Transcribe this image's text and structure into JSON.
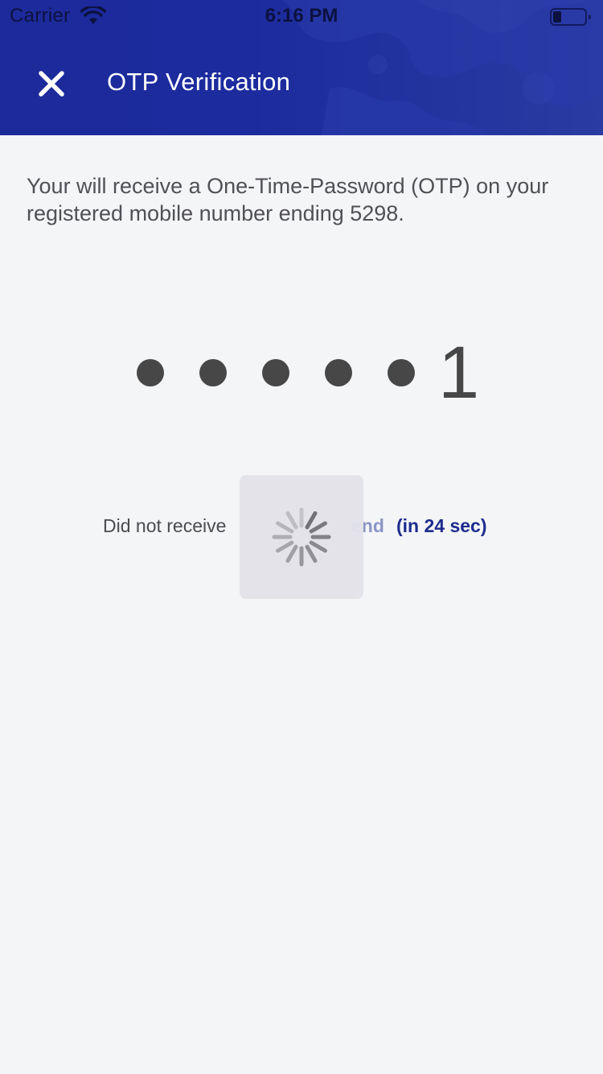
{
  "status_bar": {
    "carrier": "Carrier",
    "time": "6:16 PM",
    "wifi_icon": "wifi-icon",
    "battery_icon": "battery-low-icon"
  },
  "header": {
    "title": "OTP Verification",
    "close_icon": "close-icon",
    "background_color": "#1d2a9a"
  },
  "main": {
    "info_text": "Your will receive a One-Time-Password (OTP) on your registered mobile number ending 5298.",
    "otp": {
      "masked_count": 5,
      "last_digit": "1"
    },
    "resend": {
      "prompt": "Did not receive",
      "link_label": "end",
      "timer": "(in 24 sec)"
    }
  },
  "loading": {
    "icon": "spinner-icon"
  },
  "colors": {
    "accent": "#1e2c8e",
    "background": "#f4f5f7",
    "text": "#505055"
  }
}
